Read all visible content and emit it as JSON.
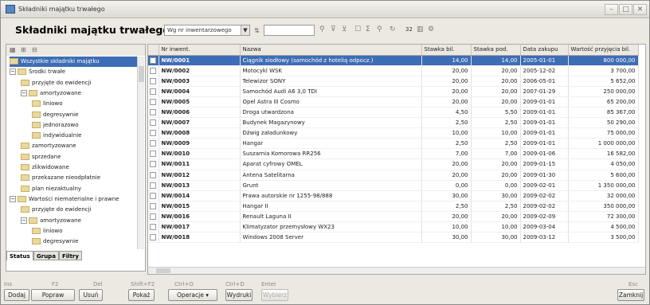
{
  "window": {
    "title": "Składniki majątku trwałego",
    "controls": [
      "–",
      "□",
      "✕"
    ]
  },
  "toolbar": {
    "heading": "Składniki majątku trwałego",
    "sort_combo": "Wg nr inwentarzowego",
    "page_size": "32"
  },
  "tree": {
    "nodes": [
      {
        "label": "Wszystkie składniki majątku",
        "level": 0,
        "exp": "",
        "selected": true
      },
      {
        "label": "Środki trwałe",
        "level": 0,
        "exp": "−"
      },
      {
        "label": "przyjęte do ewidencji",
        "level": 1,
        "exp": ""
      },
      {
        "label": "amortyzowane",
        "level": 1,
        "exp": "−"
      },
      {
        "label": "liniowo",
        "level": 2,
        "exp": ""
      },
      {
        "label": "degresywnie",
        "level": 2,
        "exp": ""
      },
      {
        "label": "jednorazowo",
        "level": 2,
        "exp": ""
      },
      {
        "label": "indywidualnie",
        "level": 2,
        "exp": ""
      },
      {
        "label": "zamortyzowane",
        "level": 1,
        "exp": ""
      },
      {
        "label": "sprzedane",
        "level": 1,
        "exp": ""
      },
      {
        "label": "zlikwidowane",
        "level": 1,
        "exp": ""
      },
      {
        "label": "przekazane nieodpłatnie",
        "level": 1,
        "exp": ""
      },
      {
        "label": "plan niezaktualny",
        "level": 1,
        "exp": ""
      },
      {
        "label": "Wartości niematerialne i prawne",
        "level": 0,
        "exp": "−"
      },
      {
        "label": "przyjęte do ewidencji",
        "level": 1,
        "exp": ""
      },
      {
        "label": "amortyzowane",
        "level": 1,
        "exp": "−"
      },
      {
        "label": "liniowo",
        "level": 2,
        "exp": ""
      },
      {
        "label": "degresywnie",
        "level": 2,
        "exp": ""
      }
    ],
    "tabs": [
      "Status",
      "Grupa",
      "Filtry"
    ]
  },
  "grid": {
    "columns": [
      "",
      "Nr inwent.",
      "Nazwa",
      "Stawka bil.",
      "Stawka pod.",
      "Data zakupu",
      "Wartość przyjęcia bil."
    ],
    "rows": [
      [
        "NW/0001",
        "Ciągnik siodłowy (samochód z hotelią odpocz.)",
        "14,00",
        "14,00",
        "2005-01-01",
        "800 000,00"
      ],
      [
        "NW/0002",
        "Motocykl WSK",
        "20,00",
        "20,00",
        "2005-12-02",
        "3 700,00"
      ],
      [
        "NW/0003",
        "Telewizor SONY",
        "20,00",
        "20,00",
        "2006-05-01",
        "5 652,00"
      ],
      [
        "NW/0004",
        "Samochód Audi A6 3,0 TDI",
        "20,00",
        "20,00",
        "2007-01-29",
        "250 000,00"
      ],
      [
        "NW/0005",
        "Opel Astra III Cosmo",
        "20,00",
        "20,00",
        "2009-01-01",
        "65 200,00"
      ],
      [
        "NW/0006",
        "Droga utwardzona",
        "4,50",
        "5,50",
        "2009-01-01",
        "85 367,00"
      ],
      [
        "NW/0007",
        "Budynek Magazynowy",
        "2,50",
        "2,50",
        "2009-01-01",
        "50 290,00"
      ],
      [
        "NW/0008",
        "Dźwig załadunkowy",
        "10,00",
        "10,00",
        "2009-01-01",
        "75 000,00"
      ],
      [
        "NW/0009",
        "Hangar",
        "2,50",
        "2,50",
        "2009-01-01",
        "1 000 000,00"
      ],
      [
        "NW/0010",
        "Suszarnia Komorowa RR256",
        "7,00",
        "7,00",
        "2009-01-06",
        "16 582,00"
      ],
      [
        "NW/0011",
        "Aparat cyfrowy OMEL",
        "20,00",
        "20,00",
        "2009-01-15",
        "4 050,00"
      ],
      [
        "NW/0012",
        "Antena Satelitarna",
        "20,00",
        "20,00",
        "2009-01-30",
        "5 600,00"
      ],
      [
        "NW/0013",
        "Grunt",
        "0,00",
        "0,00",
        "2009-02-01",
        "1 350 000,00"
      ],
      [
        "NW/0014",
        "Prawa autorskie nr 1255-98/888",
        "30,00",
        "30,00",
        "2009-02-02",
        "32 000,00"
      ],
      [
        "NW/0015",
        "Hangar II",
        "2,50",
        "2,50",
        "2009-02-02",
        "350 000,00"
      ],
      [
        "NW/0016",
        "Renault Laguna II",
        "20,00",
        "20,00",
        "2009-02-09",
        "72 300,00"
      ],
      [
        "NW/0017",
        "Klimatyzator przemysłowy WX23",
        "10,00",
        "10,00",
        "2009-03-04",
        "4 500,00"
      ],
      [
        "NW/0018",
        "Windows 2008 Server",
        "30,00",
        "30,00",
        "2009-03-12",
        "3 500,00"
      ]
    ]
  },
  "shortcuts": [
    {
      "key": "Ins",
      "button": "Dodaj"
    },
    {
      "key": "F2",
      "button": "Popraw"
    },
    {
      "key": "Del",
      "button": "Usuń"
    },
    {
      "key": "Shift+F2",
      "button": "Pokaż"
    },
    {
      "key": "Ctrl+O",
      "button": "Operacje"
    },
    {
      "key": "Ctrl+D",
      "button": "Wydruki"
    },
    {
      "key": "Enter",
      "button": "Wybierz"
    },
    {
      "key": "Esc",
      "button": "Zamknij"
    }
  ]
}
